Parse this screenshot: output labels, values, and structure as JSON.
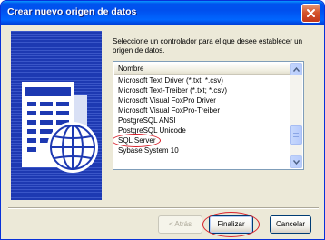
{
  "window": {
    "title": "Crear nuevo origen de datos",
    "close_icon": "close-x-icon"
  },
  "illustration": {
    "icon": "data-source-globe-icon"
  },
  "instructions": "Seleccione un controlador para el que desee establecer un origen de datos.",
  "driver_list": {
    "column_header": "Nombre",
    "items": [
      {
        "label": "Microsoft Text Driver (*.txt; *.csv)"
      },
      {
        "label": "Microsoft Text-Treiber (*.txt; *.csv)"
      },
      {
        "label": "Microsoft Visual FoxPro Driver"
      },
      {
        "label": "Microsoft Visual FoxPro-Treiber"
      },
      {
        "label": "PostgreSQL ANSI"
      },
      {
        "label": "PostgreSQL Unicode"
      },
      {
        "label": "SQL Server"
      },
      {
        "label": "Sybase System 10"
      }
    ],
    "selected": "SQL Server",
    "colors": {
      "highlight_ring": "#d8202a"
    }
  },
  "buttons": {
    "back": "< Atrás",
    "finish": "Finalizar",
    "cancel": "Cancelar"
  },
  "colors": {
    "titlebar": "#0053ee",
    "dialog_bg": "#ece9d8",
    "illustration_bg": "#1d39b2"
  }
}
